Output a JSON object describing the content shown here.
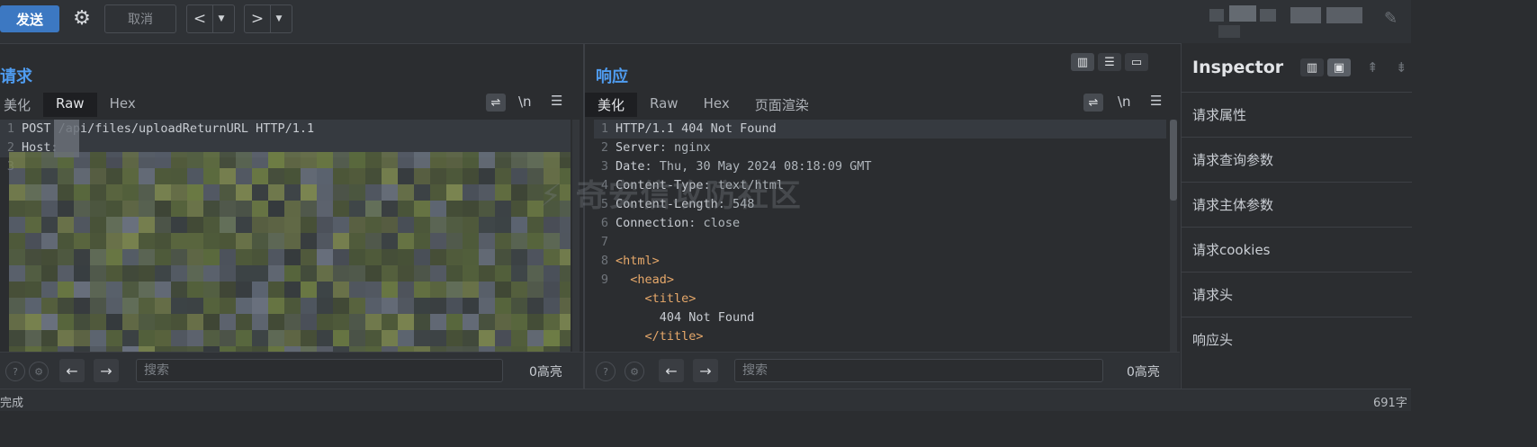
{
  "toolbar": {
    "send_label": "发送",
    "cancel_label": "取消",
    "back_icon": "<",
    "forward_icon": ">",
    "caret": "▼"
  },
  "request": {
    "title": "请求",
    "tabs": [
      "美化",
      "Raw",
      "Hex"
    ],
    "active_tab": "Raw",
    "newline_label": "\\n",
    "lines": [
      {
        "n": "1",
        "text": "POST /api/files/uploadReturnURL HTTP/1.1"
      },
      {
        "n": "2",
        "text": "Host:"
      },
      {
        "n": "3",
        "text": ""
      }
    ],
    "search_placeholder": "搜索",
    "hits": "0高亮"
  },
  "response": {
    "title": "响应",
    "tabs": [
      "美化",
      "Raw",
      "Hex",
      "页面渲染"
    ],
    "active_tab": "美化",
    "newline_label": "\\n",
    "lines": [
      {
        "n": "1",
        "key": "HTTP/1.1 404 Not Found",
        "val": ""
      },
      {
        "n": "2",
        "key": "Server",
        "val": ": nginx"
      },
      {
        "n": "3",
        "key": "Date",
        "val": ": Thu, 30 May 2024 08:18:09 GMT"
      },
      {
        "n": "4",
        "key": "Content-Type",
        "val": ": text/html"
      },
      {
        "n": "5",
        "key": "Content-Length",
        "val": ": 548"
      },
      {
        "n": "6",
        "key": "Connection",
        "val": ": close"
      },
      {
        "n": "7",
        "key": "",
        "val": ""
      },
      {
        "n": "8",
        "key": "<html>",
        "val": ""
      },
      {
        "n": "9",
        "key": "  <head>",
        "val": ""
      },
      {
        "n": "",
        "key": "    <title>",
        "val": ""
      },
      {
        "n": "",
        "key": "      404 Not Found",
        "val": ""
      },
      {
        "n": "",
        "key": "    </title>",
        "val": ""
      }
    ],
    "search_placeholder": "搜索",
    "hits": "0高亮"
  },
  "inspector": {
    "title": "Inspector",
    "items": [
      "请求属性",
      "请求查询参数",
      "请求主体参数",
      "请求cookies",
      "请求头",
      "响应头"
    ]
  },
  "status": {
    "left": "完成",
    "right": "691字"
  },
  "watermark": "奇安信攻防社区",
  "colors": {
    "accent": "#3c78c2",
    "title_blue": "#4f9cf0",
    "tag_orange": "#e6a86a"
  }
}
